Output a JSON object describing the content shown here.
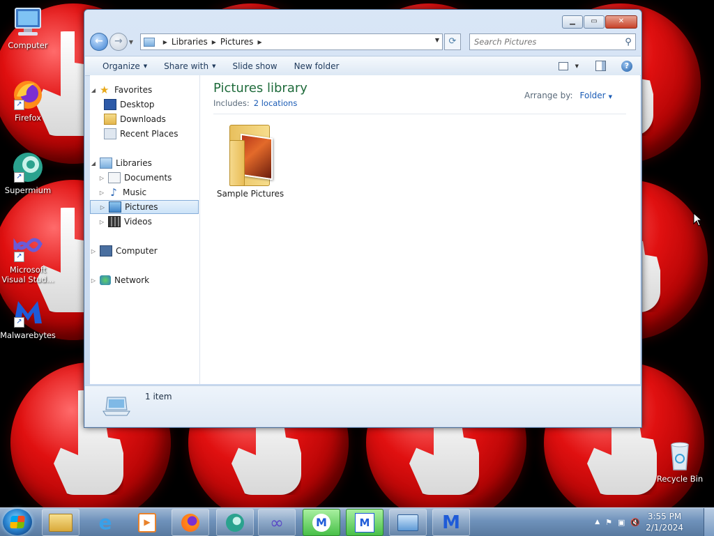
{
  "desktop": {
    "icons": [
      {
        "label": "Computer",
        "icon": "computer-icon"
      },
      {
        "label": "Firefox",
        "icon": "firefox-icon"
      },
      {
        "label": "Supermium",
        "icon": "supermium-icon"
      },
      {
        "label": "Microsoft Visual Stud...",
        "icon": "visual-studio-icon"
      },
      {
        "label": "Malwarebytes",
        "icon": "malwarebytes-icon"
      },
      {
        "label": "Recycle Bin",
        "icon": "recycle-bin-icon"
      }
    ]
  },
  "window": {
    "breadcrumb": [
      "Libraries",
      "Pictures"
    ],
    "search_placeholder": "Search Pictures",
    "toolbar": {
      "organize": "Organize",
      "share_with": "Share with",
      "slide_show": "Slide show",
      "new_folder": "New folder"
    },
    "nav": {
      "favorites": {
        "label": "Favorites",
        "items": [
          "Desktop",
          "Downloads",
          "Recent Places"
        ]
      },
      "libraries": {
        "label": "Libraries",
        "items": [
          "Documents",
          "Music",
          "Pictures",
          "Videos"
        ]
      },
      "computer": "Computer",
      "network": "Network",
      "selected": "Pictures"
    },
    "library": {
      "title": "Pictures library",
      "includes_label": "Includes:",
      "includes_link": "2 locations",
      "arrange_label": "Arrange by:",
      "arrange_value": "Folder"
    },
    "items": [
      {
        "name": "Sample Pictures",
        "icon": "folder-icon"
      }
    ],
    "details": {
      "count": "1 item"
    }
  },
  "taskbar": {
    "apps": [
      "explorer",
      "internet-explorer",
      "media-player",
      "firefox",
      "supermium",
      "visual-studio",
      "malwarebytes",
      "malwarebytes-setup",
      "control-panel",
      "malwarebytes"
    ],
    "clock": {
      "time": "3:55 PM",
      "date": "2/1/2024"
    }
  },
  "colors": {
    "library_title": "#1f6b3b",
    "link": "#1a5bb5",
    "selection": "#cce3f8"
  }
}
